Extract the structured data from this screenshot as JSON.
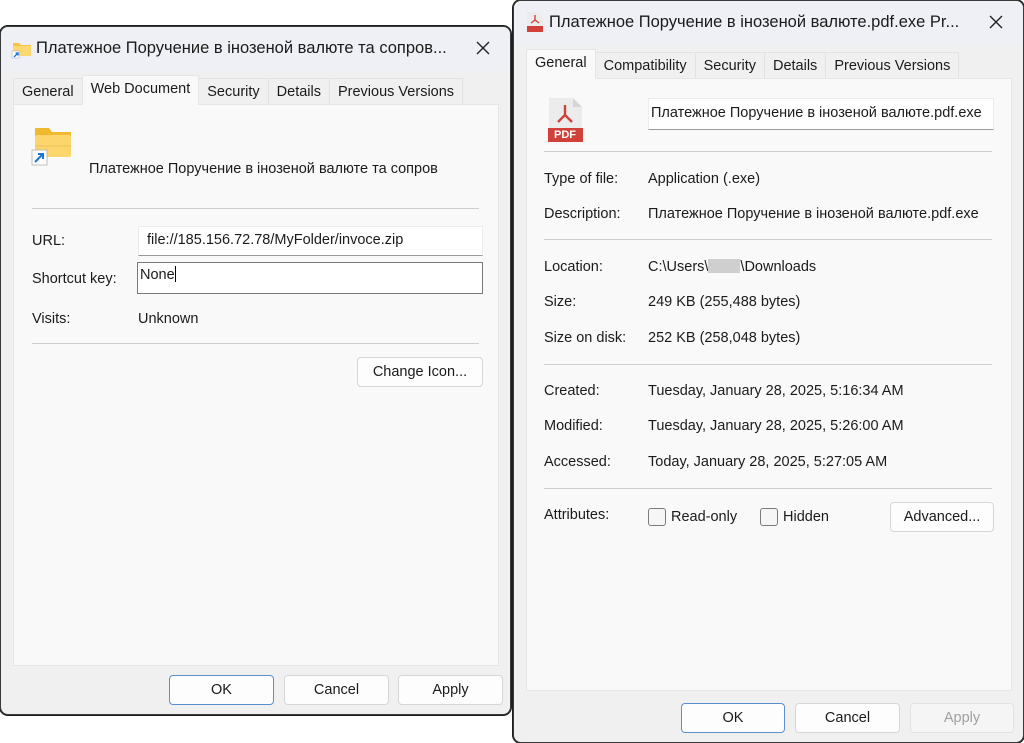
{
  "left_window": {
    "title": "Платежное Поручение в інозеной валюте та сопров...",
    "title_icon": "folder-shortcut-icon",
    "tabs": [
      {
        "label": "General",
        "active": false
      },
      {
        "label": "Web Document",
        "active": true
      },
      {
        "label": "Security",
        "active": false
      },
      {
        "label": "Details",
        "active": false
      },
      {
        "label": "Previous Versions",
        "active": false
      }
    ],
    "file_icon": "folder-shortcut-icon",
    "file_name": "Платежное Поручение в інозеной валюте та сопров",
    "url_label": "URL:",
    "url_value": "file://185.156.72.78/MyFolder/invoce.zip",
    "shortcut_key_label": "Shortcut key:",
    "shortcut_key_value": "None",
    "visits_label": "Visits:",
    "visits_value": "Unknown",
    "change_icon_button": "Change Icon...",
    "buttons": {
      "ok": "OK",
      "cancel": "Cancel",
      "apply": "Apply"
    }
  },
  "right_window": {
    "title": "Платежное Поручение в інозеной валюте.pdf.exe Pr...",
    "title_icon": "pdf-file-icon",
    "tabs": [
      {
        "label": "General",
        "active": true
      },
      {
        "label": "Compatibility",
        "active": false
      },
      {
        "label": "Security",
        "active": false
      },
      {
        "label": "Details",
        "active": false
      },
      {
        "label": "Previous Versions",
        "active": false
      }
    ],
    "file_icon": "pdf-file-icon",
    "pdf_badge": "PDF",
    "file_name_value": "Платежное Поручение в інозеной валюте.pdf.exe",
    "properties": {
      "type_label": "Type of file:",
      "type_value": "Application (.exe)",
      "description_label": "Description:",
      "description_value": "Платежное Поручение в інозеной валюте.pdf.exe",
      "location_label": "Location:",
      "location_prefix": "C:\\Users\\",
      "location_suffix": "\\Downloads",
      "size_label": "Size:",
      "size_value": "249 KB (255,488 bytes)",
      "size_on_disk_label": "Size on disk:",
      "size_on_disk_value": "252 KB (258,048 bytes)",
      "created_label": "Created:",
      "created_value": "Tuesday, January 28, 2025, 5:16:34 AM",
      "modified_label": "Modified:",
      "modified_value": "Tuesday, January 28, 2025, 5:26:00 AM",
      "accessed_label": "Accessed:",
      "accessed_value": "Today, January 28, 2025, 5:27:05 AM",
      "attributes_label": "Attributes:",
      "readonly_label": "Read-only",
      "readonly_checked": false,
      "hidden_label": "Hidden",
      "hidden_checked": false,
      "advanced_button": "Advanced..."
    },
    "buttons": {
      "ok": "OK",
      "cancel": "Cancel",
      "apply": "Apply"
    }
  }
}
